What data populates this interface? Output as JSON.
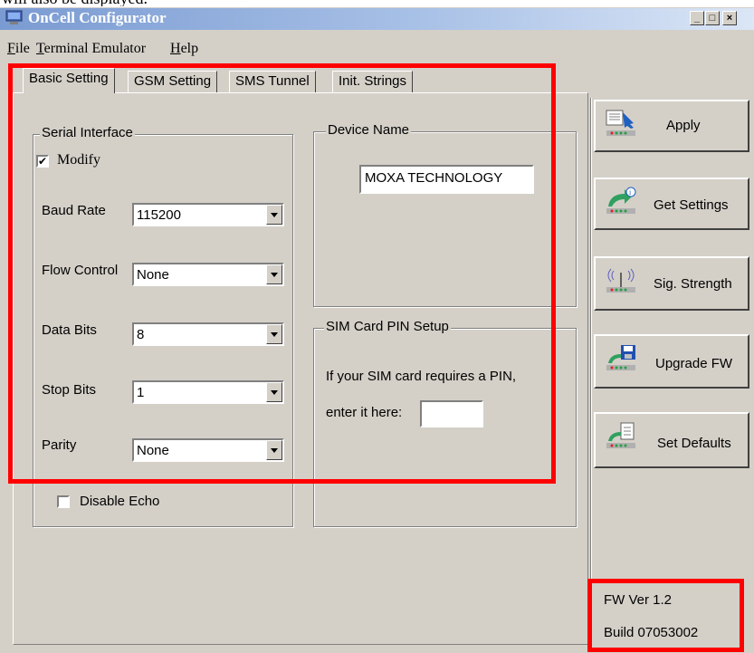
{
  "caption": "will also be displayed.",
  "window": {
    "title": "OnCell Configurator"
  },
  "menu": [
    {
      "label": "File",
      "mnemonic": "F"
    },
    {
      "label": "Terminal Emulator",
      "mnemonic": "T"
    },
    {
      "label": "Help",
      "mnemonic": "H"
    }
  ],
  "tabs": [
    "Basic Setting",
    "GSM Setting",
    "SMS Tunnel",
    "Init. Strings"
  ],
  "serial": {
    "title": "Serial Interface",
    "modify_label": "Modify",
    "modify_checked": true,
    "baud_label": "Baud Rate",
    "baud_value": "115200",
    "flow_label": "Flow Control",
    "flow_value": "None",
    "data_label": "Data Bits",
    "data_value": "8",
    "stop_label": "Stop Bits",
    "stop_value": "1",
    "parity_label": "Parity",
    "parity_value": "None",
    "echo_label": "Disable Echo",
    "echo_checked": false
  },
  "device": {
    "title": "Device Name",
    "value": "MOXA TECHNOLOGY"
  },
  "sim": {
    "title": "SIM Card PIN Setup",
    "line1": "If your SIM card requires a PIN,",
    "line2": "enter it here:",
    "pin_value": ""
  },
  "buttons": {
    "apply": "Apply",
    "get": "Get Settings",
    "sig": "Sig. Strength",
    "upgrade": "Upgrade FW",
    "defaults": "Set Defaults"
  },
  "version": {
    "fw": "FW Ver 1.2",
    "build": "Build 07053002"
  },
  "colors": {
    "highlight": "#ff0000",
    "window_bg": "#d4d0c8",
    "title_start": "#7a9bd2"
  }
}
